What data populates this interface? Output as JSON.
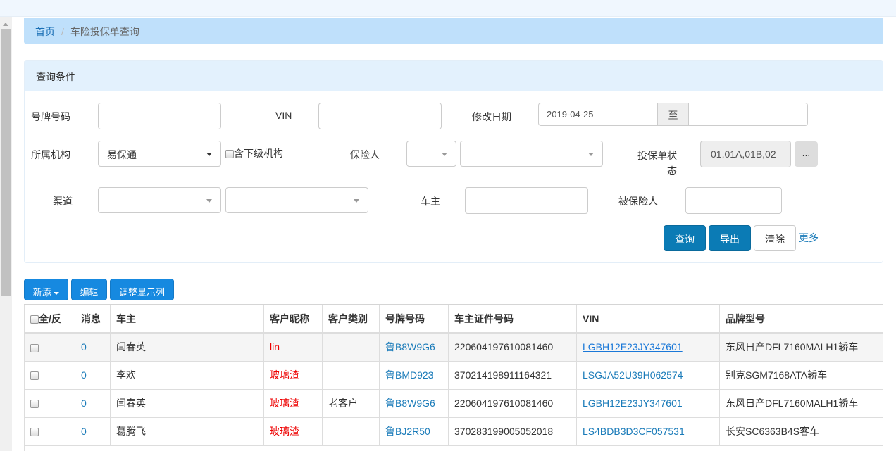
{
  "breadcrumb": {
    "home": "首页",
    "current": "车险投保单查询"
  },
  "panel": {
    "title": "查询条件"
  },
  "form": {
    "plate_label": "号牌号码",
    "plate_value": "",
    "vin_label": "VIN",
    "vin_value": "",
    "date_label": "修改日期",
    "date_from": "2019-04-25",
    "date_to_label": "至",
    "date_to": "",
    "org_label": "所属机构",
    "org_value": "易保通",
    "sub_org_label": "含下级机构",
    "insurer_label": "保险人",
    "insurer_type": "",
    "insurer_value": "",
    "status_label": "投保单状态",
    "status_value": "01,01A,01B,02",
    "status_more": "...",
    "channel_label": "渠道",
    "channel_1": "",
    "channel_2": "",
    "owner_label": "车主",
    "owner_value": "",
    "insured_label": "被保险人",
    "insured_value": ""
  },
  "actions": {
    "query": "查询",
    "export": "导出",
    "clear": "清除",
    "more": "更多"
  },
  "toolbar": {
    "new": "新添",
    "edit": "编辑",
    "columns": "调整显示列"
  },
  "table": {
    "headers": [
      "全/反",
      "消息",
      "车主",
      "客户昵称",
      "客户类别",
      "号牌号码",
      "车主证件号码",
      "VIN",
      "品牌型号"
    ],
    "rows": [
      {
        "msg": "0",
        "owner": "闫春英",
        "nick": "lin",
        "type": "",
        "plate": "鲁B8W9G6",
        "id": "220604197610081460",
        "vin": "LGBH12E23JY347601",
        "model": "东风日产DFL7160MALH1轿车"
      },
      {
        "msg": "0",
        "owner": "李欢",
        "nick": "玻璃渣",
        "type": "",
        "plate": "鲁BMD923",
        "id": "370214198911164321",
        "vin": "LSGJA52U39H062574",
        "model": "别克SGM7168ATA轿车"
      },
      {
        "msg": "0",
        "owner": "闫春英",
        "nick": "玻璃渣",
        "type": "老客户",
        "plate": "鲁B8W9G6",
        "id": "220604197610081460",
        "vin": "LGBH12E23JY347601",
        "model": "东风日产DFL7160MALH1轿车"
      },
      {
        "msg": "0",
        "owner": "葛腾飞",
        "nick": "玻璃渣",
        "type": "",
        "plate": "鲁BJ2R50",
        "id": "370283199005052018",
        "vin": "LS4BDB3D3CF057531",
        "model": "长安SC6363B4S客车"
      }
    ]
  }
}
